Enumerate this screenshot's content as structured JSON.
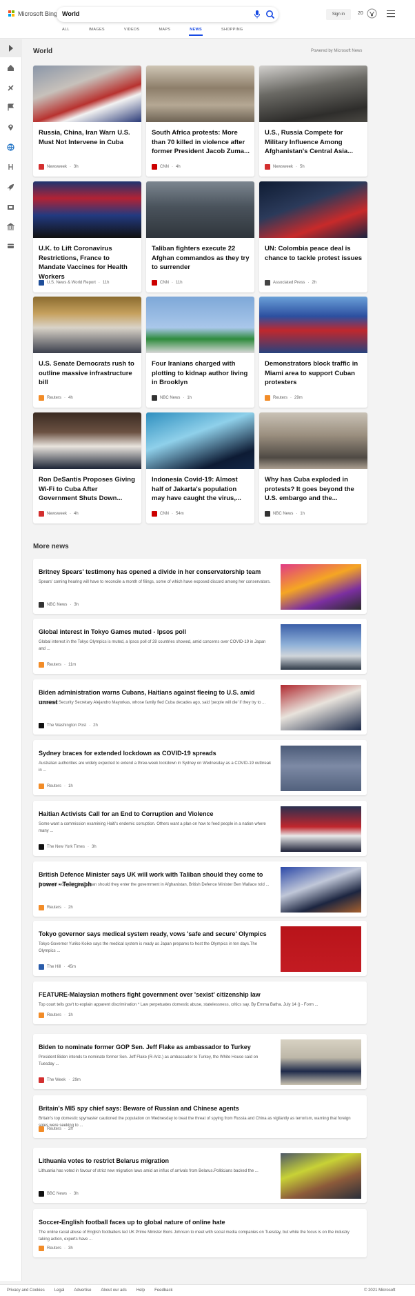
{
  "header": {
    "logo_text": "Microsoft Bing",
    "search_value": "World",
    "signin": "Sign in",
    "rewards_count": "20",
    "nav": [
      "ALL",
      "IMAGES",
      "VIDEOS",
      "MAPS",
      "NEWS",
      "SHOPPING"
    ],
    "active_nav": "NEWS"
  },
  "sidebar": {
    "icons": [
      "expand-icon",
      "home-icon",
      "satellite-icon",
      "flag-icon",
      "location-icon",
      "globe-icon",
      "science-icon",
      "rocket-icon",
      "film-icon",
      "bank-icon",
      "wallet-icon"
    ]
  },
  "world": {
    "title": "World",
    "powered": "Powered by Microsoft News",
    "cards": [
      {
        "title": "Russia, China, Iran Warn U.S. Must Not Intervene in Cuba",
        "source": "Newsweek",
        "age": "3h",
        "logo_color": "#d32f2f"
      },
      {
        "title": "South Africa protests: More than 70 killed in violence after former President Jacob Zuma...",
        "source": "CNN",
        "age": "4h",
        "logo_color": "#cc0000"
      },
      {
        "title": "U.S., Russia Compete for Military Influence Among Afghanistan's Central Asia...",
        "source": "Newsweek",
        "age": "5h",
        "logo_color": "#d32f2f"
      },
      {
        "title": "U.K. to Lift Coronavirus Restrictions, France to Mandate Vaccines for Health Workers",
        "source": "U.S. News & World Report",
        "age": "11h",
        "logo_color": "#1f4e99"
      },
      {
        "title": "Taliban fighters execute 22 Afghan commandos as they try to surrender",
        "source": "CNN",
        "age": "11h",
        "logo_color": "#cc0000"
      },
      {
        "title": "UN: Colombia peace deal is chance to tackle protest issues",
        "source": "Associated Press",
        "age": "2h",
        "logo_color": "#444444"
      },
      {
        "title": "U.S. Senate Democrats rush to outline massive infrastructure bill",
        "source": "Reuters",
        "age": "4h",
        "logo_color": "#f28c28"
      },
      {
        "title": "Four Iranians charged with plotting to kidnap author living in Brooklyn",
        "source": "NBC News",
        "age": "1h",
        "logo_color": "#333333"
      },
      {
        "title": "Demonstrators block traffic in Miami area to support Cuban protesters",
        "source": "Reuters",
        "age": "29m",
        "logo_color": "#f28c28"
      },
      {
        "title": "Ron DeSantis Proposes Giving Wi-Fi to Cuba After Government Shuts Down...",
        "source": "Newsweek",
        "age": "4h",
        "logo_color": "#d32f2f"
      },
      {
        "title": "Indonesia Covid-19: Almost half of Jakarta's population may have caught the virus,...",
        "source": "CNN",
        "age": "54m",
        "logo_color": "#cc0000"
      },
      {
        "title": "Why has Cuba exploded in protests? It goes beyond the U.S. embargo and the...",
        "source": "NBC News",
        "age": "1h",
        "logo_color": "#333333"
      }
    ]
  },
  "more_news": {
    "title": "More news",
    "items": [
      {
        "title": "Britney Spears' testimony has opened a divide in her conservatorship team",
        "snippet": "Spears' coming hearing will have to reconcile a month of filings, some of which have exposed discord among her conservators.",
        "source": "NBC News",
        "age": "3h",
        "logo_color": "#333333",
        "has_image": true
      },
      {
        "title": "Global interest in Tokyo Games muted - Ipsos poll",
        "snippet": "Global interest in the Tokyo Olympics is muted, a Ipsos poll of 28 countries showed, amid concerns over COVID-19 in Japan and ...",
        "source": "Reuters",
        "age": "11m",
        "logo_color": "#f28c28",
        "has_image": true
      },
      {
        "title": "Biden administration warns Cubans, Haitians against fleeing to U.S. amid unrest",
        "snippet": "Homeland Security Secretary Alejandro Mayorkas, whose family fled Cuba decades ago, said 'people will die' if they try to ...",
        "source": "The Washington Post",
        "age": "2h",
        "logo_color": "#111111",
        "has_image": true
      },
      {
        "title": "Sydney braces for extended lockdown as COVID-19 spreads",
        "snippet": "Australian authorities are widely expected to extend a three-week lockdown in Sydney on Wednesday as a COVID-19 outbreak in ...",
        "source": "Reuters",
        "age": "1h",
        "logo_color": "#f28c28",
        "has_image": true
      },
      {
        "title": "Haitian Activists Call for an End to Corruption and Violence",
        "snippet": "Some want a commission examining Haiti's endemic corruption. Others want a plan on how to feed people in a nation where many ...",
        "source": "The New York Times",
        "age": "3h",
        "logo_color": "#111111",
        "has_image": true
      },
      {
        "title": "British Defence Minister says UK will work with Taliban should they come to power - Telegraph",
        "snippet": "Britain will work with the Taliban should they enter the government in Afghanistan, British Defence Minister Ben Wallace told ...",
        "source": "Reuters",
        "age": "2h",
        "logo_color": "#f28c28",
        "has_image": true
      },
      {
        "title": "Tokyo governor says medical system ready, vows 'safe and secure' Olympics",
        "snippet": "Tokyo Governor Yuriko Koike says the medical system is ready as Japan prepares to host the Olympics in ten days.The Olympics ...",
        "source": "The Hill",
        "age": "45m",
        "logo_color": "#2a5caa",
        "has_image": true
      },
      {
        "title": "FEATURE-Malaysian mothers fight government over 'sexist' citizenship law",
        "snippet": "Top court tells gov't to explain apparent discrimination * Law perpetuates domestic abuse, statelessness, critics say. By Emma Batha. July 14 () - Form ...",
        "source": "Reuters",
        "age": "1h",
        "logo_color": "#f28c28",
        "has_image": false
      },
      {
        "title": "Biden to nominate former GOP Sen. Jeff Flake as ambassador to Turkey",
        "snippet": "President Biden intends to nominate former Sen. Jeff Flake (R-Ariz.) as ambassador to Turkey, the White House said on Tuesday ...",
        "source": "The Week",
        "age": "29m",
        "logo_color": "#d32f2f",
        "has_image": true
      },
      {
        "title": "Britain's MI5 spy chief says: Beware of Russian and Chinese agents",
        "snippet": "Britain's top domestic spymaster cautioned the population on Wednesday to treat the threat of spying from Russia and China as vigilantly as terrorism, warning that foreign spies were seeking to ...",
        "source": "Reuters",
        "age": "2h",
        "logo_color": "#f28c28",
        "has_image": false
      },
      {
        "title": "Lithuania votes to restrict Belarus migration",
        "snippet": "Lithuania has voted in favour of strict new migration laws amid an influx of arrivals from Belarus.Politicians backed the ...",
        "source": "BBC News",
        "age": "3h",
        "logo_color": "#111111",
        "has_image": true
      },
      {
        "title": "Soccer-English football faces up to global nature of online hate",
        "snippet": "The online racial abuse of English footballers led UK Prime Minister Boris Johnson to meet with social media companies on Tuesday, but while the focus is on the industry taking action, experts have ...",
        "source": "Reuters",
        "age": "3h",
        "logo_color": "#f28c28",
        "has_image": false
      }
    ]
  },
  "footer": {
    "links": [
      "Privacy and Cookies",
      "Legal",
      "Advertise",
      "About our ads",
      "Help",
      "Feedback"
    ],
    "copyright": "© 2021 Microsoft"
  }
}
